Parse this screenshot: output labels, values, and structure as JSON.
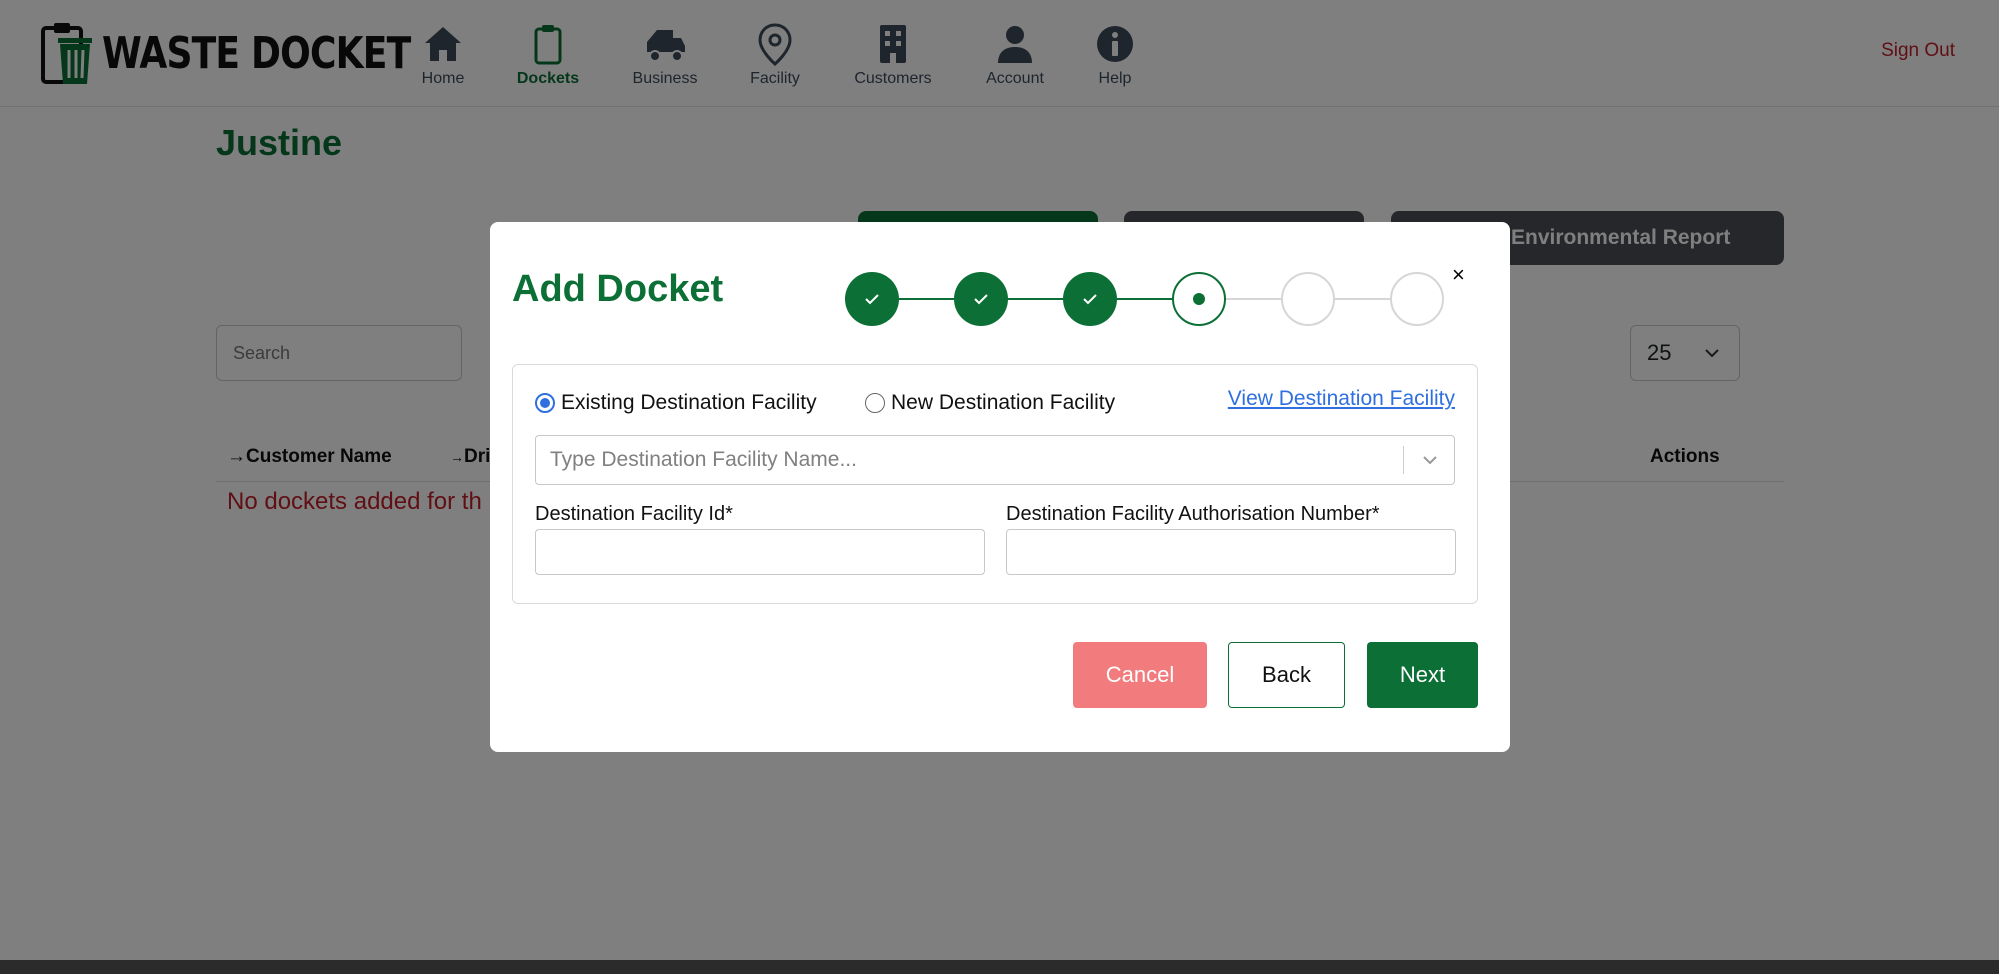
{
  "app": {
    "brand": "WASTE DOCKET",
    "sign_out": "Sign Out"
  },
  "nav": [
    {
      "label": "Home",
      "icon": "home-icon"
    },
    {
      "label": "Dockets",
      "icon": "clipboard-icon",
      "active": true
    },
    {
      "label": "Business",
      "icon": "truck-icon"
    },
    {
      "label": "Facility",
      "icon": "location-pin-icon"
    },
    {
      "label": "Customers",
      "icon": "building-icon"
    },
    {
      "label": "Account",
      "icon": "user-icon"
    },
    {
      "label": "Help",
      "icon": "info-icon"
    }
  ],
  "page": {
    "customer_name": "Justine",
    "environmental_report": "Environmental Report",
    "search_placeholder": "Search",
    "per_page": "25",
    "columns": [
      "Customer Name",
      "Dri",
      "Actions"
    ],
    "empty_message": "No dockets added for th"
  },
  "modal": {
    "title": "Add Docket",
    "steps": [
      "done",
      "done",
      "done",
      "current",
      "todo",
      "todo"
    ],
    "radio_existing": "Existing Destination Facility",
    "radio_new": "New Destination Facility",
    "view_link": "View Destination Facility",
    "select_placeholder": "Type Destination Facility Name...",
    "field_id_label": "Destination Facility Id*",
    "field_auth_label": "Destination Facility Authorisation Number*",
    "field_id_value": "",
    "field_auth_value": "",
    "cancel": "Cancel",
    "back": "Back",
    "next": "Next",
    "close": "×"
  },
  "colors": {
    "brand_green": "#0b6f36",
    "danger": "#c0212a",
    "cancel_bg": "#f27b7d",
    "link": "#2f6fe0",
    "dark_button": "#4a4f55"
  }
}
